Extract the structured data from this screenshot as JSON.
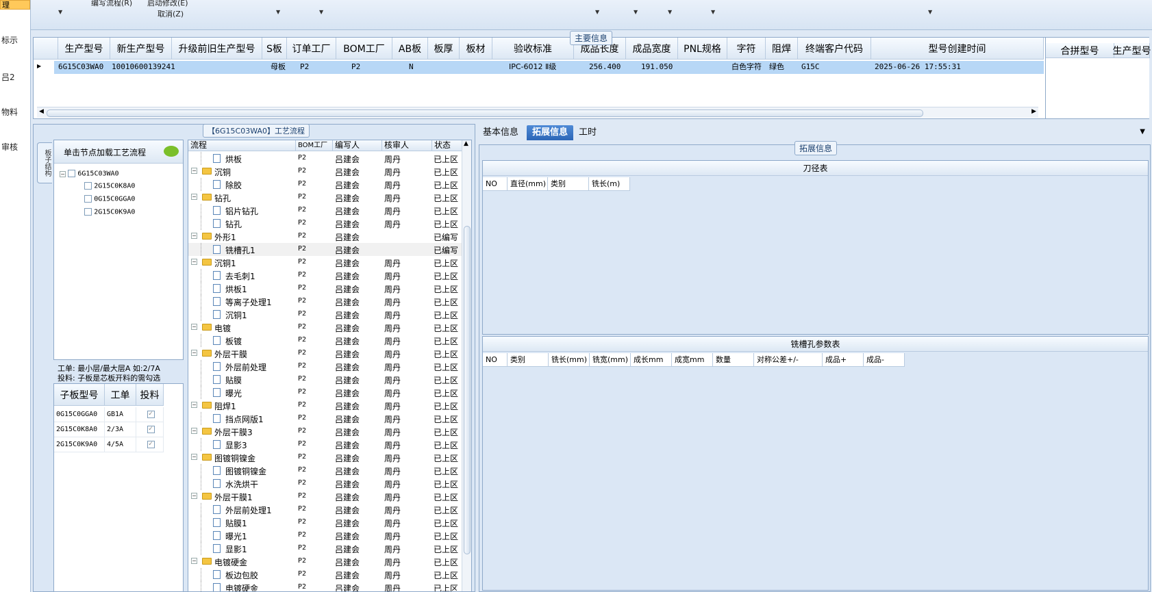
{
  "left_strip": {
    "items": [
      "理",
      "标示",
      "吕2",
      "物料",
      "审核"
    ]
  },
  "toolbar": {
    "numbering_process": "编写流程(R)",
    "start_modify": "启动修改(E)",
    "cancel": "取消(Z)"
  },
  "main_info": {
    "title": "主要信息",
    "columns": [
      "生产型号",
      "新生产型号",
      "升级前旧生产型号",
      "S板",
      "订单工厂",
      "BOM工厂",
      "AB板",
      "板厚",
      "板材",
      "验收标准",
      "成品长度",
      "成品宽度",
      "PNL规格",
      "字符",
      "阻焊",
      "终端客户代码",
      "型号创建时间"
    ],
    "row": {
      "production_model": "6G15C03WA0",
      "new_production_model": "10010600139241",
      "old_model": "",
      "s_board": "母板",
      "order_factory": "P2",
      "bom_factory": "P2",
      "ab_board": "N",
      "thickness": "",
      "material": "",
      "acceptance": "IPC-6012 Ⅱ级",
      "length": "256.400",
      "width": "191.050",
      "pnl": "",
      "character": "白色字符",
      "solder_mask": "绿色",
      "customer_code": "G15C",
      "created": "2025-06-26 17:55:31"
    },
    "merge_columns": [
      "合拼型号",
      "生产型号"
    ]
  },
  "flow_panel": {
    "title": "【6G15C03WA0】工艺流程",
    "vtab_label": "板子结构",
    "tree_hint": "单击节点加载工艺流程",
    "tree_root": "6G15C03WA0",
    "tree_children": [
      "2G15C0K8A0",
      "0G15C0GGA0",
      "2G15C0K9A0"
    ],
    "note_line1": "工单: 最小层/最大层A 如:2/7A",
    "note_line2": "投料: 子板是芯板开料的需勾选",
    "sub_columns": [
      "子板型号",
      "工单",
      "投料"
    ],
    "sub_rows": [
      {
        "model": "0G15C0GGA0",
        "order": "GB1A"
      },
      {
        "model": "2G15C0K8A0",
        "order": "2/3A"
      },
      {
        "model": "2G15C0K9A0",
        "order": "4/5A"
      }
    ],
    "flow_columns": [
      "流程",
      "BOM工厂",
      "编写人",
      "核审人",
      "状态"
    ],
    "flow_rows": [
      {
        "level": 2,
        "type": "doc",
        "name": "烘板",
        "bom": "P2",
        "writer": "吕建会",
        "reviewer": "周丹",
        "status": "已上区"
      },
      {
        "level": 1,
        "type": "folder",
        "name": "沉铜",
        "bom": "P2",
        "writer": "吕建会",
        "reviewer": "周丹",
        "status": "已上区"
      },
      {
        "level": 2,
        "type": "doc",
        "name": "除胶",
        "bom": "P2",
        "writer": "吕建会",
        "reviewer": "周丹",
        "status": "已上区"
      },
      {
        "level": 1,
        "type": "folder",
        "name": "钻孔",
        "bom": "P2",
        "writer": "吕建会",
        "reviewer": "周丹",
        "status": "已上区"
      },
      {
        "level": 2,
        "type": "doc",
        "name": "铝片钻孔",
        "bom": "P2",
        "writer": "吕建会",
        "reviewer": "周丹",
        "status": "已上区"
      },
      {
        "level": 2,
        "type": "doc",
        "name": "钻孔",
        "bom": "P2",
        "writer": "吕建会",
        "reviewer": "周丹",
        "status": "已上区"
      },
      {
        "level": 1,
        "type": "folder",
        "name": "外形1",
        "bom": "P2",
        "writer": "吕建会",
        "reviewer": "",
        "status": "已编写"
      },
      {
        "level": 2,
        "type": "doc",
        "name": "铣槽孔1",
        "bom": "P2",
        "writer": "吕建会",
        "reviewer": "",
        "status": "已编写"
      },
      {
        "level": 1,
        "type": "folder",
        "name": "沉铜1",
        "bom": "P2",
        "writer": "吕建会",
        "reviewer": "周丹",
        "status": "已上区"
      },
      {
        "level": 2,
        "type": "doc",
        "name": "去毛刺1",
        "bom": "P2",
        "writer": "吕建会",
        "reviewer": "周丹",
        "status": "已上区"
      },
      {
        "level": 2,
        "type": "doc",
        "name": "烘板1",
        "bom": "P2",
        "writer": "吕建会",
        "reviewer": "周丹",
        "status": "已上区"
      },
      {
        "level": 2,
        "type": "doc",
        "name": "等离子处理1",
        "bom": "P2",
        "writer": "吕建会",
        "reviewer": "周丹",
        "status": "已上区"
      },
      {
        "level": 2,
        "type": "doc",
        "name": "沉铜1",
        "bom": "P2",
        "writer": "吕建会",
        "reviewer": "周丹",
        "status": "已上区"
      },
      {
        "level": 1,
        "type": "folder",
        "name": "电镀",
        "bom": "P2",
        "writer": "吕建会",
        "reviewer": "周丹",
        "status": "已上区"
      },
      {
        "level": 2,
        "type": "doc",
        "name": "板镀",
        "bom": "P2",
        "writer": "吕建会",
        "reviewer": "周丹",
        "status": "已上区"
      },
      {
        "level": 1,
        "type": "folder",
        "name": "外层干膜",
        "bom": "P2",
        "writer": "吕建会",
        "reviewer": "周丹",
        "status": "已上区"
      },
      {
        "level": 2,
        "type": "doc",
        "name": "外层前处理",
        "bom": "P2",
        "writer": "吕建会",
        "reviewer": "周丹",
        "status": "已上区"
      },
      {
        "level": 2,
        "type": "doc",
        "name": "贴膜",
        "bom": "P2",
        "writer": "吕建会",
        "reviewer": "周丹",
        "status": "已上区"
      },
      {
        "level": 2,
        "type": "doc",
        "name": "曝光",
        "bom": "P2",
        "writer": "吕建会",
        "reviewer": "周丹",
        "status": "已上区"
      },
      {
        "level": 1,
        "type": "folder",
        "name": "阻焊1",
        "bom": "P2",
        "writer": "吕建会",
        "reviewer": "周丹",
        "status": "已上区"
      },
      {
        "level": 2,
        "type": "doc",
        "name": "挡点网版1",
        "bom": "P2",
        "writer": "吕建会",
        "reviewer": "周丹",
        "status": "已上区"
      },
      {
        "level": 1,
        "type": "folder",
        "name": "外层干膜3",
        "bom": "P2",
        "writer": "吕建会",
        "reviewer": "周丹",
        "status": "已上区"
      },
      {
        "level": 2,
        "type": "doc",
        "name": "显影3",
        "bom": "P2",
        "writer": "吕建会",
        "reviewer": "周丹",
        "status": "已上区"
      },
      {
        "level": 1,
        "type": "folder",
        "name": "图镀铜镍金",
        "bom": "P2",
        "writer": "吕建会",
        "reviewer": "周丹",
        "status": "已上区"
      },
      {
        "level": 2,
        "type": "doc",
        "name": "图镀铜镍金",
        "bom": "P2",
        "writer": "吕建会",
        "reviewer": "周丹",
        "status": "已上区"
      },
      {
        "level": 2,
        "type": "doc",
        "name": "水洗烘干",
        "bom": "P2",
        "writer": "吕建会",
        "reviewer": "周丹",
        "status": "已上区"
      },
      {
        "level": 1,
        "type": "folder",
        "name": "外层干膜1",
        "bom": "P2",
        "writer": "吕建会",
        "reviewer": "周丹",
        "status": "已上区"
      },
      {
        "level": 2,
        "type": "doc",
        "name": "外层前处理1",
        "bom": "P2",
        "writer": "吕建会",
        "reviewer": "周丹",
        "status": "已上区"
      },
      {
        "level": 2,
        "type": "doc",
        "name": "贴膜1",
        "bom": "P2",
        "writer": "吕建会",
        "reviewer": "周丹",
        "status": "已上区"
      },
      {
        "level": 2,
        "type": "doc",
        "name": "曝光1",
        "bom": "P2",
        "writer": "吕建会",
        "reviewer": "周丹",
        "status": "已上区"
      },
      {
        "level": 2,
        "type": "doc",
        "name": "显影1",
        "bom": "P2",
        "writer": "吕建会",
        "reviewer": "周丹",
        "status": "已上区"
      },
      {
        "level": 1,
        "type": "folder",
        "name": "电镀硬金",
        "bom": "P2",
        "writer": "吕建会",
        "reviewer": "周丹",
        "status": "已上区"
      },
      {
        "level": 2,
        "type": "doc",
        "name": "板边包胶",
        "bom": "P2",
        "writer": "吕建会",
        "reviewer": "周丹",
        "status": "已上区"
      },
      {
        "level": 2,
        "type": "doc",
        "name": "电镀硬金",
        "bom": "P2",
        "writer": "吕建会",
        "reviewer": "周丹",
        "status": "已上区"
      }
    ]
  },
  "right_panel": {
    "tabs": [
      "基本信息",
      "拓展信息",
      "工时"
    ],
    "active_tab": "拓展信息",
    "group_title": "拓展信息",
    "knife_table": {
      "title": "刀径表",
      "columns": [
        "NO",
        "直径(mm)",
        "类别",
        "铣长(m)"
      ]
    },
    "slot_table": {
      "title": "铣槽孔参数表",
      "columns": [
        "NO",
        "类别",
        "铣长(mm)",
        "铣宽(mm)",
        "成长mm",
        "成宽mm",
        "数量",
        "对称公差+/-",
        "成品+",
        "成品-"
      ]
    }
  },
  "colors": {
    "accent": "#2c66b7",
    "selected_row": "#b7d7f6",
    "panel_bg": "#dbe7f5"
  }
}
